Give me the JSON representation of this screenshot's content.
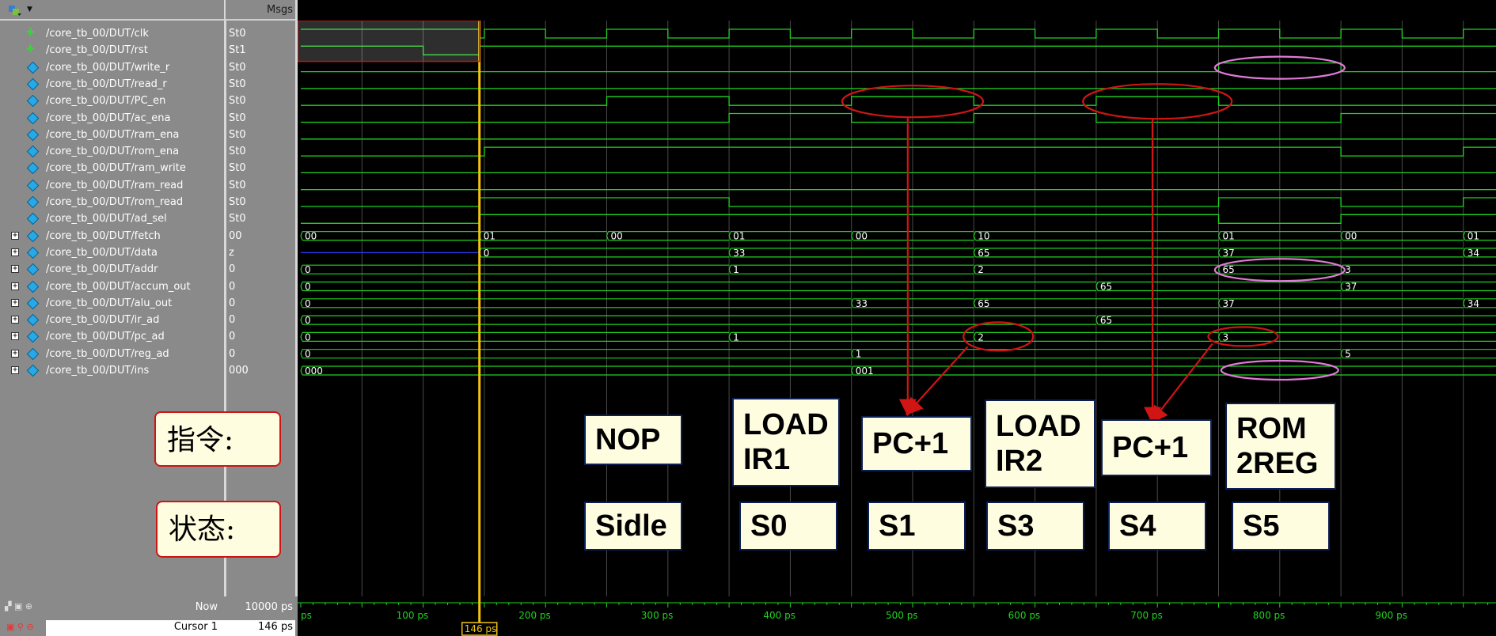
{
  "header": {
    "msgs_label": "Msgs"
  },
  "signals": [
    {
      "name": "/core_tb_00/DUT/clk",
      "value": "St0",
      "kind": "clk",
      "expandable": false
    },
    {
      "name": "/core_tb_00/DUT/rst",
      "value": "St1",
      "kind": "clk",
      "expandable": false
    },
    {
      "name": "/core_tb_00/DUT/write_r",
      "value": "St0",
      "kind": "bit",
      "expandable": false
    },
    {
      "name": "/core_tb_00/DUT/read_r",
      "value": "St0",
      "kind": "bit",
      "expandable": false
    },
    {
      "name": "/core_tb_00/DUT/PC_en",
      "value": "St0",
      "kind": "bit",
      "expandable": false
    },
    {
      "name": "/core_tb_00/DUT/ac_ena",
      "value": "St0",
      "kind": "bit",
      "expandable": false
    },
    {
      "name": "/core_tb_00/DUT/ram_ena",
      "value": "St0",
      "kind": "bit",
      "expandable": false
    },
    {
      "name": "/core_tb_00/DUT/rom_ena",
      "value": "St0",
      "kind": "bit",
      "expandable": false
    },
    {
      "name": "/core_tb_00/DUT/ram_write",
      "value": "St0",
      "kind": "bit",
      "expandable": false
    },
    {
      "name": "/core_tb_00/DUT/ram_read",
      "value": "St0",
      "kind": "bit",
      "expandable": false
    },
    {
      "name": "/core_tb_00/DUT/rom_read",
      "value": "St0",
      "kind": "bit",
      "expandable": false
    },
    {
      "name": "/core_tb_00/DUT/ad_sel",
      "value": "St0",
      "kind": "bit",
      "expandable": false
    },
    {
      "name": "/core_tb_00/DUT/fetch",
      "value": "00",
      "kind": "bus",
      "expandable": true
    },
    {
      "name": "/core_tb_00/DUT/data",
      "value": "z",
      "kind": "bus",
      "expandable": true
    },
    {
      "name": "/core_tb_00/DUT/addr",
      "value": "0",
      "kind": "bus",
      "expandable": true
    },
    {
      "name": "/core_tb_00/DUT/accum_out",
      "value": "0",
      "kind": "bus",
      "expandable": true
    },
    {
      "name": "/core_tb_00/DUT/alu_out",
      "value": "0",
      "kind": "bus",
      "expandable": true
    },
    {
      "name": "/core_tb_00/DUT/ir_ad",
      "value": "0",
      "kind": "bus",
      "expandable": true
    },
    {
      "name": "/core_tb_00/DUT/pc_ad",
      "value": "0",
      "kind": "bus",
      "expandable": true
    },
    {
      "name": "/core_tb_00/DUT/reg_ad",
      "value": "0",
      "kind": "bus",
      "expandable": true
    },
    {
      "name": "/core_tb_00/DUT/ins",
      "value": "000",
      "kind": "bus",
      "expandable": true
    }
  ],
  "bus_segments": {
    "fetch": [
      [
        "00",
        0
      ],
      [
        "01",
        146
      ],
      [
        "00",
        250
      ],
      [
        "01",
        350
      ],
      [
        "00",
        450
      ],
      [
        "10",
        550
      ],
      [
        "01",
        750
      ],
      [
        "00",
        850
      ],
      [
        "01",
        950
      ]
    ],
    "data": [
      [
        "0",
        146
      ],
      [
        "33",
        350
      ],
      [
        "65",
        550
      ],
      [
        "37",
        750
      ],
      [
        "34",
        950
      ]
    ],
    "addr": [
      [
        "0",
        0
      ],
      [
        "1",
        350
      ],
      [
        "2",
        550
      ],
      [
        "65",
        750
      ],
      [
        "3",
        850
      ]
    ],
    "accum_out": [
      [
        "0",
        0
      ],
      [
        "65",
        650
      ],
      [
        "37",
        850
      ]
    ],
    "alu_out": [
      [
        "0",
        0
      ],
      [
        "33",
        450
      ],
      [
        "65",
        550
      ],
      [
        "37",
        750
      ],
      [
        "34",
        950
      ]
    ],
    "ir_ad": [
      [
        "0",
        0
      ],
      [
        "65",
        650
      ]
    ],
    "pc_ad": [
      [
        "0",
        0
      ],
      [
        "1",
        350
      ],
      [
        "2",
        550
      ],
      [
        "3",
        750
      ]
    ],
    "reg_ad": [
      [
        "0",
        0
      ],
      [
        "1",
        450
      ],
      [
        "5",
        850
      ]
    ],
    "ins": [
      [
        "000",
        0
      ],
      [
        "001",
        450
      ]
    ]
  },
  "timeline": {
    "ticks": [
      "ps",
      "100 ps",
      "200 ps",
      "300 ps",
      "400 ps",
      "500 ps",
      "600 ps",
      "700 ps",
      "800 ps",
      "900 ps"
    ],
    "now_label": "Now",
    "now_value": "10000 ps",
    "cursor_label": "Cursor 1",
    "cursor_value": "146 ps",
    "cursor_flag": "146 ps",
    "cursor_time_ps": 146
  },
  "annotations": {
    "instr_label": "指令:",
    "state_label": "状态:",
    "instructions": [
      "NOP",
      "LOAD\nIR1",
      "PC+1",
      "LOAD\nIR2",
      "PC+1",
      "ROM\n2REG"
    ],
    "states": [
      "Sidle",
      "S0",
      "S1",
      "S3",
      "S4",
      "S5"
    ]
  },
  "colors": {
    "wave": "#1fd41f",
    "bus_z": "#2a3cff",
    "cursor": "#f2c40f",
    "arrow": "#d11414",
    "pink": "#e07ad8"
  }
}
